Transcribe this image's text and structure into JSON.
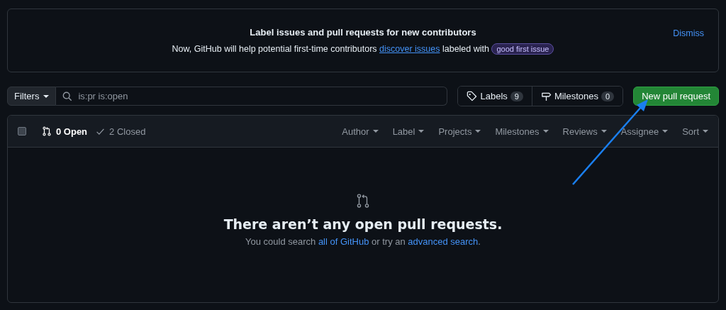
{
  "banner": {
    "title": "Label issues and pull requests for new contributors",
    "text_before": "Now, GitHub will help potential first-time contributors",
    "link": "discover issues",
    "text_after": "labeled with",
    "label": "good first issue",
    "dismiss": "Dismiss"
  },
  "toolbar": {
    "filters_button": "Filters",
    "search_value": "is:pr is:open",
    "nav": [
      {
        "kind": "tag",
        "label": "Labels",
        "count": "9"
      },
      {
        "kind": "milestone",
        "label": "Milestones",
        "count": "0"
      }
    ],
    "new_button": "New pull request"
  },
  "list_header": {
    "select_all_checked": false,
    "states": [
      {
        "kind": "open",
        "label": "0 Open",
        "selected": true
      },
      {
        "kind": "closed",
        "label": "2 Closed",
        "selected": false
      }
    ],
    "menus": [
      "Author",
      "Label",
      "Projects",
      "Milestones",
      "Reviews",
      "Assignee",
      "Sort"
    ]
  },
  "empty_state": {
    "title": "There aren’t any open pull requests.",
    "text_before": "You could search",
    "link_1": "all of GitHub",
    "text_middle": "or try an",
    "link_2": "advanced search",
    "text_after": "."
  },
  "annotation": {
    "kind": "arrow"
  }
}
